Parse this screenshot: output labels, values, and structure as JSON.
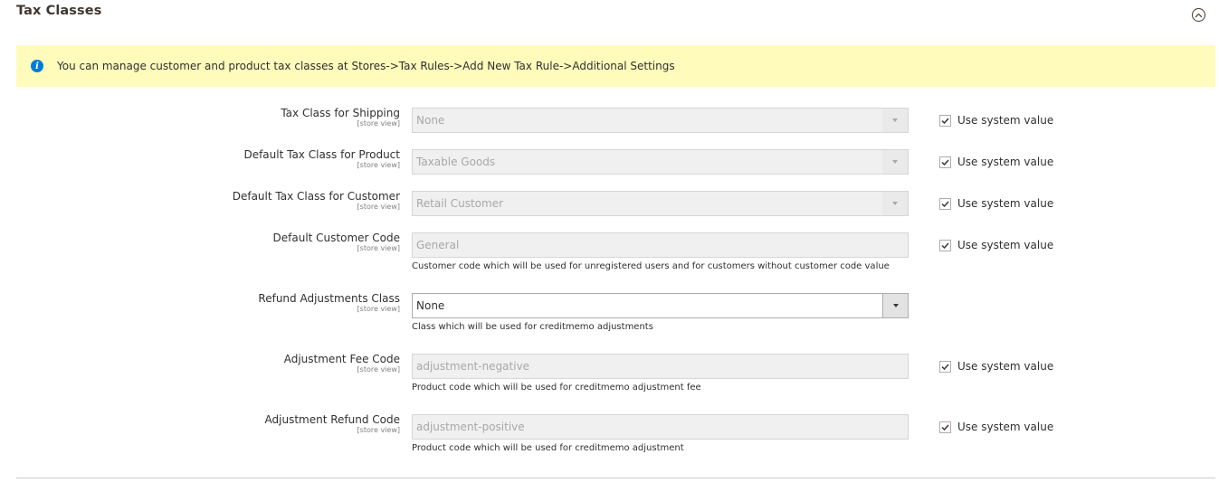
{
  "section": {
    "title": "Tax Classes",
    "collapse_icon": "chevron-up-circle-icon"
  },
  "notice": {
    "icon": "info-icon",
    "icon_glyph": "i",
    "text": "You can manage customer and product tax classes at Stores->Tax Rules->Add New Tax Rule->Additional Settings"
  },
  "fields": [
    {
      "label": "Tax Class for Shipping",
      "scope": "[store view]",
      "type": "select",
      "value": "None",
      "disabled": true,
      "use_system_value": true,
      "use_system_label": "Use system value"
    },
    {
      "label": "Default Tax Class for Product",
      "scope": "[store view]",
      "type": "select",
      "value": "Taxable Goods",
      "disabled": true,
      "use_system_value": true,
      "use_system_label": "Use system value"
    },
    {
      "label": "Default Tax Class for Customer",
      "scope": "[store view]",
      "type": "select",
      "value": "Retail Customer",
      "disabled": true,
      "use_system_value": true,
      "use_system_label": "Use system value"
    },
    {
      "label": "Default Customer Code",
      "scope": "[store view]",
      "type": "text",
      "value": "General",
      "disabled": true,
      "note": "Customer code which will be used for unregistered users and for customers without customer code value",
      "use_system_value": true,
      "use_system_label": "Use system value"
    },
    {
      "label": "Refund Adjustments Class",
      "scope": "[store view]",
      "type": "select",
      "value": "None",
      "disabled": false,
      "note": "Class which will be used for creditmemo adjustments"
    },
    {
      "label": "Adjustment Fee Code",
      "scope": "[store view]",
      "type": "text",
      "value": "adjustment-negative",
      "disabled": true,
      "note": "Product code which will be used for creditmemo adjustment fee",
      "use_system_value": true,
      "use_system_label": "Use system value"
    },
    {
      "label": "Adjustment Refund Code",
      "scope": "[store view]",
      "type": "text",
      "value": "adjustment-positive",
      "disabled": true,
      "note": "Product code which will be used for creditmemo adjustment",
      "use_system_value": true,
      "use_system_label": "Use system value"
    }
  ],
  "colors": {
    "notice_bg": "#fffbbb",
    "info_icon": "#007bdb",
    "disabled_bg": "#f0f0f0",
    "text": "#303030"
  }
}
